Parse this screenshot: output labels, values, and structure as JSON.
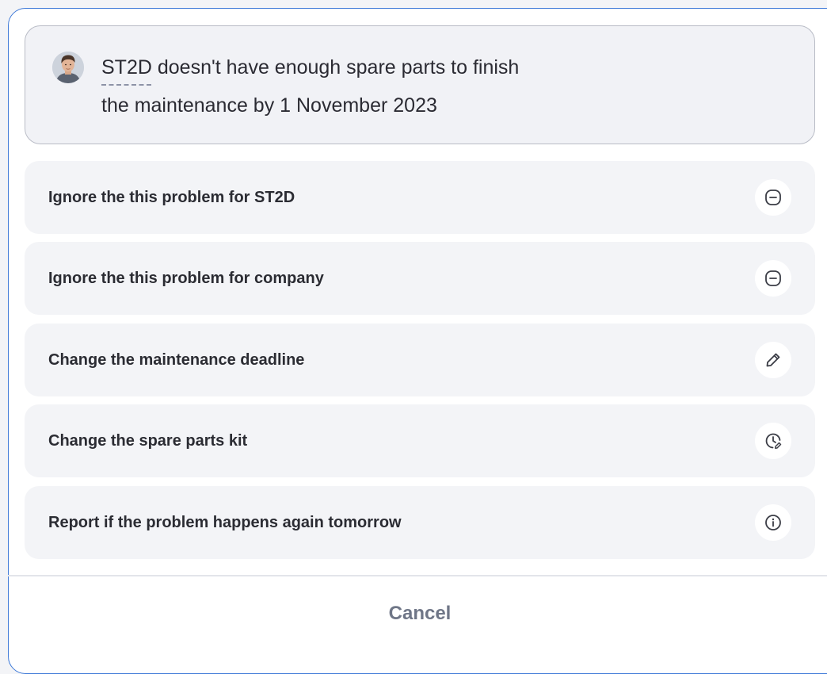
{
  "notice": {
    "mention": "ST2D",
    "line1_rest": " doesn't have enough spare parts to finish",
    "line2": "the maintenance by 1 November 2023"
  },
  "options": [
    {
      "label": "Ignore the this problem for ST2D",
      "icon": "minus-circle-icon"
    },
    {
      "label": "Ignore the this problem for company",
      "icon": "minus-circle-icon"
    },
    {
      "label": "Change the maintenance deadline",
      "icon": "pencil-icon"
    },
    {
      "label": "Change the spare parts kit",
      "icon": "clock-edit-icon"
    },
    {
      "label": "Report if the problem happens again tomorrow",
      "icon": "info-icon"
    }
  ],
  "footer": {
    "cancel_label": "Cancel"
  },
  "colors": {
    "accent_border": "#3f7ad8",
    "card_background": "#f1f2f6",
    "option_background": "#f3f4f7",
    "text_primary": "#2b2c33",
    "cancel_text": "#6f7687"
  }
}
